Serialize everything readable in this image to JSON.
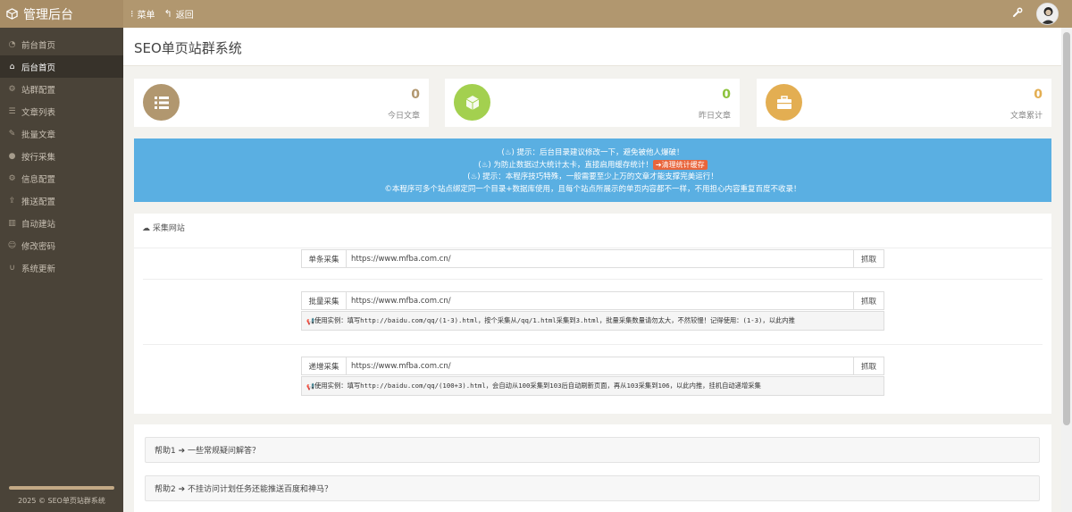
{
  "brand": {
    "title": "管理后台"
  },
  "topnav": {
    "menu": "菜单",
    "back": "返回"
  },
  "sidebar": {
    "items": [
      {
        "label": "前台首页",
        "icon": "dashboard-icon"
      },
      {
        "label": "后台首页",
        "icon": "home-icon",
        "active": true
      },
      {
        "label": "站群配置",
        "icon": "gear-icon"
      },
      {
        "label": "文章列表",
        "icon": "list-icon"
      },
      {
        "label": "批量文章",
        "icon": "edit-icon"
      },
      {
        "label": "按行采集",
        "icon": "dot-icon"
      },
      {
        "label": "信息配置",
        "icon": "settings-icon"
      },
      {
        "label": "推送配置",
        "icon": "upload-icon"
      },
      {
        "label": "自动建站",
        "icon": "bank-icon"
      },
      {
        "label": "修改密码",
        "icon": "user-icon"
      },
      {
        "label": "系统更新",
        "icon": "magnet-icon"
      }
    ],
    "progress": 1.0,
    "footer": "2025 © SEO单页站群系统"
  },
  "page": {
    "title": "SEO单页站群系统"
  },
  "stats": [
    {
      "value": "0",
      "label": "今日文章",
      "color": "#b1976f",
      "num_color": "#b1976f",
      "icon": "list-icon"
    },
    {
      "value": "0",
      "label": "昨日文章",
      "color": "#a3d04f",
      "num_color": "#8cc23c",
      "icon": "cube-icon"
    },
    {
      "value": "0",
      "label": "文章累计",
      "color": "#e3ae52",
      "num_color": "#e3ae52",
      "icon": "briefcase-icon"
    }
  ],
  "notice": {
    "line1": "(♨) 提示：后台目录建议修改一下，避免被他人爆破！",
    "line2": "(♨) 为防止数据过大统计太卡，直接启用缓存统计！",
    "clear_btn": "➔清理统计缓存",
    "line3": "(♨) 提示：本程序技巧特殊，一般需要至少上万的文章才能支撑完美运行！",
    "line4": "©本程序可多个站点绑定同一个目录+数据库使用，且每个站点所展示的单页内容都不一样，不用担心内容重复百度不收录！"
  },
  "collect": {
    "header": "采集网站",
    "single": {
      "label": "单条采集",
      "value": "https://www.mfba.com.cn/",
      "button": "抓取"
    },
    "batch": {
      "label": "批量采集",
      "value": "https://www.mfba.com.cn/",
      "button": "抓取",
      "hint": "使用实例：填写http://baidu.com/qq/(1-3).html，按个采集从/qq/1.html采集到3.html，批量采集数量请勿太大，不然较慢！记得使用：(1-3)，以此内推"
    },
    "incr": {
      "label": "递增采集",
      "value": "https://www.mfba.com.cn/",
      "button": "抓取",
      "hint": "使用实例：填写http://baidu.com/qq/(100+3).html，会自动从100采集到103后自动刷新页面，再从103采集到106，以此内推，挂机自动递增采集"
    }
  },
  "faq": [
    {
      "label": "帮助1 ➔ 一些常规疑问解答？"
    },
    {
      "label": "帮助2 ➔ 不挂访问计划任务还能推送百度和神马？"
    }
  ]
}
